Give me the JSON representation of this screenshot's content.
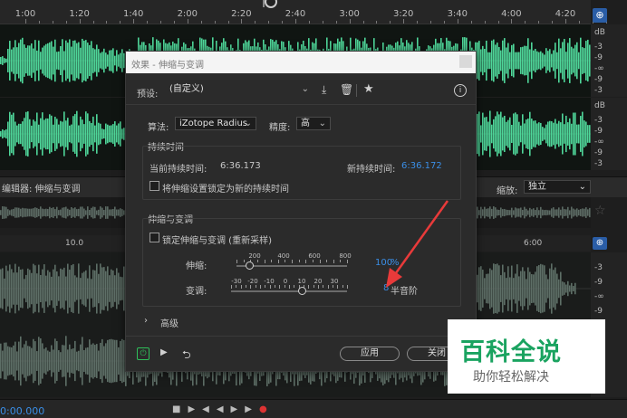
{
  "timeline": {
    "ticks": [
      "1:00",
      "1:20",
      "1:40",
      "2:00",
      "2:20",
      "2:40",
      "3:00",
      "3:20",
      "3:40",
      "4:00",
      "4:20"
    ]
  },
  "db_scale": {
    "upper": [
      "dB",
      "-3",
      "-9",
      "-∞",
      "-9",
      "-3"
    ],
    "lower": [
      "dB",
      "-3",
      "-9",
      "-∞",
      "-9",
      "-3"
    ]
  },
  "editor": {
    "title": "编辑器: 伸缩与变调",
    "zoom_label": "缩放:",
    "zoom_value": "独立"
  },
  "lower_ruler": {
    "ticks": [
      "10.0",
      "6:00"
    ]
  },
  "lower_db_scale": [
    "-3",
    "-9",
    "-∞",
    "-9",
    "-3"
  ],
  "dialog": {
    "title": "效果 - 伸缩与变调",
    "preset_label": "预设:",
    "preset_value": "(自定义)",
    "algorithm_label": "算法:",
    "algorithm_value": "iZotope Radius",
    "precision_label": "精度:",
    "precision_value": "高",
    "duration_group": "持续时间",
    "current_duration_label": "当前持续时间:",
    "current_duration_value": "6:36.173",
    "new_duration_label": "新持续时间:",
    "new_duration_value": "6:36.172",
    "lock_duration_label": "将伸缩设置锁定为新的持续时间",
    "lock_duration_checked": false,
    "stretch_group": "伸缩与变调",
    "lock_stretch_label": "锁定伸缩与变调 (重新采样)",
    "lock_stretch_checked": false,
    "stretch_label": "伸缩:",
    "stretch_scale": [
      "200",
      "400",
      "600",
      "800"
    ],
    "stretch_value": "100",
    "stretch_unit": "%",
    "stretch_level_percent": 100,
    "pitch_label": "变调:",
    "pitch_scale": [
      "-30",
      "-20",
      "-10",
      "0",
      "10",
      "20",
      "30"
    ],
    "pitch_value": "8",
    "pitch_unit": "半音阶",
    "pitch_level_semitones": 8,
    "advanced_label": "高级",
    "apply_label": "应用",
    "close_label": "关闭"
  },
  "watermark": {
    "main": "百科全说",
    "sub": "助你轻松解决"
  },
  "transport": {
    "time": "0:00.000"
  },
  "colors": {
    "waveform": "#4fd79a",
    "waveform_dim": "#6f8a7e",
    "accent_blue": "#3a8ee6",
    "arrow_red": "#e83a3a",
    "watermark_green": "#1aa360"
  }
}
